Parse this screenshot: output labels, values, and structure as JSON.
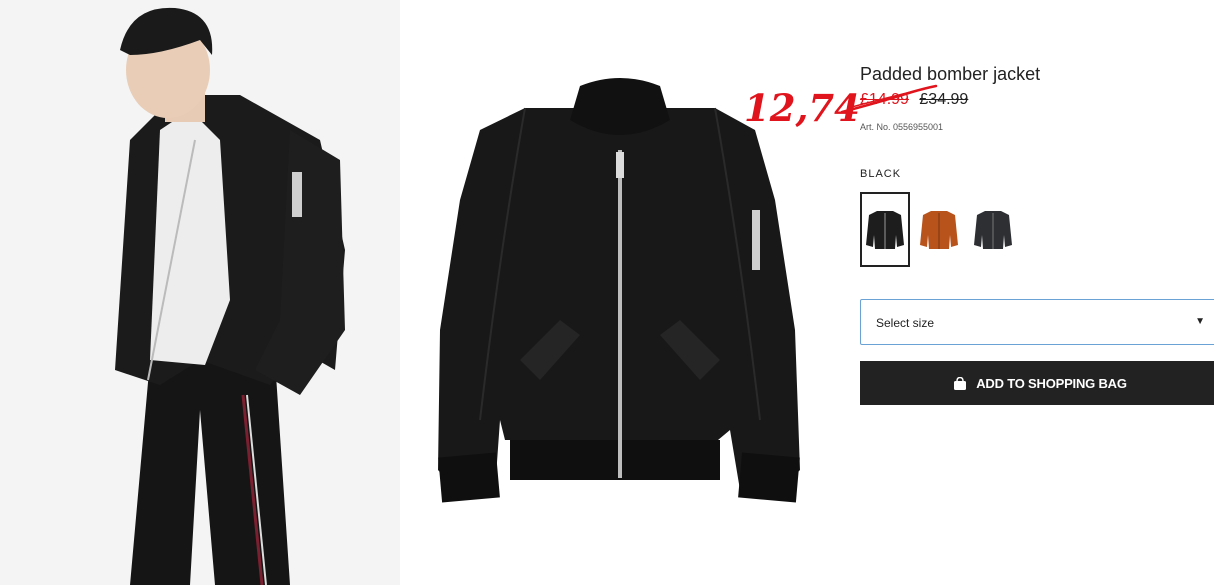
{
  "product": {
    "title": "Padded bomber jacket",
    "sale_price": "12,74",
    "old_price": "£14.99",
    "regular_price": "£34.99",
    "article_no": "Art. No. 0556955001"
  },
  "colors": {
    "selected_label": "BLACK",
    "options": [
      {
        "name": "black",
        "hex": "#1d1d1d"
      },
      {
        "name": "rust",
        "hex": "#b8531c"
      },
      {
        "name": "dark-grey",
        "hex": "#2e2f33"
      }
    ]
  },
  "size_select": {
    "label": "Select size"
  },
  "add_to_bag": {
    "label": "ADD TO SHOPPING BAG"
  },
  "theme": {
    "sale_red": "#e0141c",
    "button_bg": "#222222",
    "select_border": "#6aa2d6"
  }
}
